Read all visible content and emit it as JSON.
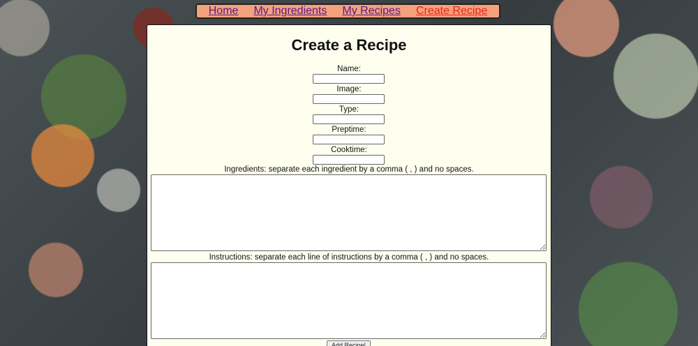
{
  "nav": {
    "home": "Home",
    "my_ingredients": "My Ingredients",
    "my_recipes": "My Recipes",
    "create_recipe": "Create Recipe"
  },
  "form": {
    "title": "Create a Recipe",
    "fields": {
      "name_label": "Name:",
      "name_value": "",
      "image_label": "Image:",
      "image_value": "",
      "type_label": "Type:",
      "type_value": "",
      "preptime_label": "Preptime:",
      "preptime_value": "",
      "cooktime_label": "Cooktime:",
      "cooktime_value": ""
    },
    "ingredients_label": "Ingredients: separate each ingredient by a comma ( , ) and no spaces.",
    "instructions_label": "Instructions: separate each line of instructions by a comma ( , ) and no spaces.",
    "submit_label": "Add Recipe!"
  },
  "colors": {
    "nav_background": "#f4a27c",
    "nav_link": "#551a8b",
    "nav_active_link": "#e8231a",
    "panel_background": "#fffff0"
  }
}
